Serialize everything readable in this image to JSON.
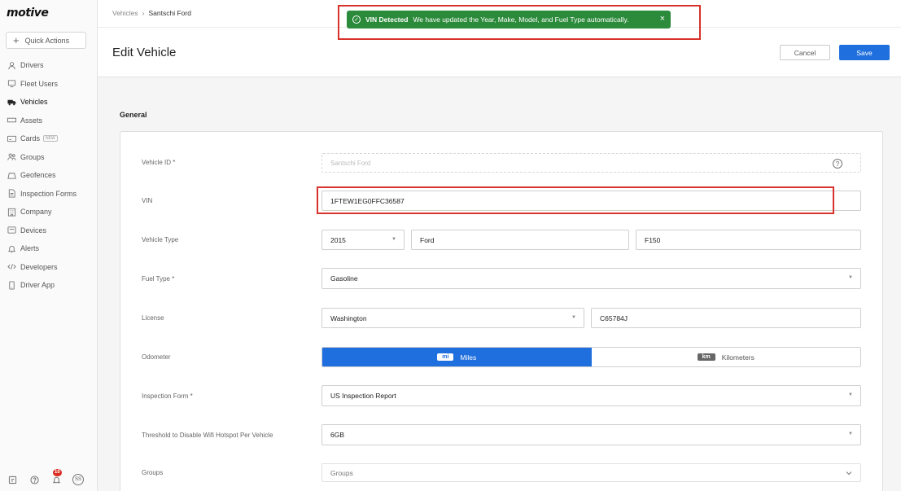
{
  "app": {
    "logo": "motive"
  },
  "sidebar": {
    "quick_actions": "Quick Actions",
    "items": [
      {
        "label": "Drivers",
        "icon": "person-icon"
      },
      {
        "label": "Fleet Users",
        "icon": "monitor-icon"
      },
      {
        "label": "Vehicles",
        "icon": "truck-icon",
        "active": true
      },
      {
        "label": "Assets",
        "icon": "trailer-icon"
      },
      {
        "label": "Cards",
        "icon": "card-icon",
        "badge": "NEW"
      },
      {
        "label": "Groups",
        "icon": "groups-icon"
      },
      {
        "label": "Geofences",
        "icon": "geofence-icon"
      },
      {
        "label": "Inspection Forms",
        "icon": "form-icon"
      },
      {
        "label": "Company",
        "icon": "building-icon"
      },
      {
        "label": "Devices",
        "icon": "devices-icon"
      },
      {
        "label": "Alerts",
        "icon": "bell-icon"
      },
      {
        "label": "Developers",
        "icon": "code-icon"
      },
      {
        "label": "Driver App",
        "icon": "phone-icon"
      }
    ],
    "footer": {
      "notifications_count": "10",
      "avatar_initials": "SS"
    }
  },
  "breadcrumb": {
    "parent": "Vehicles",
    "separator": "›",
    "current": "Santschi Ford"
  },
  "header": {
    "title": "Edit Vehicle",
    "cancel": "Cancel",
    "save": "Save"
  },
  "toast": {
    "title": "VIN Detected",
    "message": "We have updated the Year, Make, Model, and Fuel Type automatically.",
    "close": "×",
    "color": "#2c8a3b"
  },
  "form": {
    "section": "General",
    "vehicle_id": {
      "label": "Vehicle ID *",
      "value": "Santschi Ford",
      "help": "?"
    },
    "vin": {
      "label": "VIN",
      "value": "1FTEW1EG0FFC36587"
    },
    "vehicle_type": {
      "label": "Vehicle Type",
      "year": "2015",
      "make": "Ford",
      "model": "F150"
    },
    "fuel_type": {
      "label": "Fuel Type *",
      "value": "Gasoline"
    },
    "license": {
      "label": "License",
      "state": "Washington",
      "plate": "C65784J"
    },
    "odometer": {
      "label": "Odometer",
      "options": [
        {
          "chip": "mi",
          "label": "Miles",
          "selected": true
        },
        {
          "chip": "km",
          "label": "Kilometers",
          "selected": false
        }
      ]
    },
    "inspection_form": {
      "label": "Inspection Form *",
      "value": "US Inspection Report"
    },
    "wifi_threshold": {
      "label": "Threshold to Disable Wifi Hotspot Per Vehicle",
      "value": "6GB"
    },
    "groups": {
      "label": "Groups",
      "placeholder": "Groups"
    }
  },
  "colors": {
    "accent": "#1f6fde",
    "highlight": "#d7322c"
  }
}
